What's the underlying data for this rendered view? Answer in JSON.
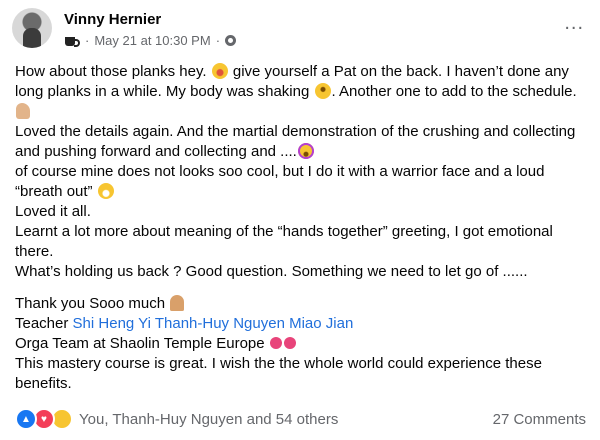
{
  "post": {
    "author": "Vinny Hernier",
    "timestamp": "May 21 at 10:30 PM",
    "separator": "·",
    "more_icon": "...",
    "icons": {
      "badge": "coffee-cup-icon",
      "audience": "globe-icon"
    }
  },
  "content": {
    "p1_a": "How about those planks hey.",
    "p1_b": "give yourself a Pat on the back. I haven’t done any long planks in a while. My body was shaking",
    "p1_c": ". Another one to add to the schedule.",
    "p2": "Loved the details again. And the martial demonstration of the crushing and collecting and pushing forward and collecting  and ....",
    "p3": "of course mine does not looks soo cool, but I do it with a warrior face and a loud “breath out”",
    "p4": " Loved it all.",
    "p5": "Learnt a lot more about meaning of the “hands together” greeting, I got emotional there.",
    "p6": "What’s holding us back ? Good question. Something we need to let go of ......",
    "p7": "Thank you Sooo much",
    "p8_prefix": "Teacher ",
    "tags": [
      "Shi Heng Yi",
      "Thanh-Huy Nguyen",
      "Miao Jian"
    ],
    "p9": "Orga Team at Shaolin Temple Europe",
    "p10": "This mastery course is great.  I wish the the whole world could experience these benefits."
  },
  "footer": {
    "reactions_summary": "You, Thanh-Huy Nguyen and 54 others",
    "comments": "27 Comments"
  }
}
